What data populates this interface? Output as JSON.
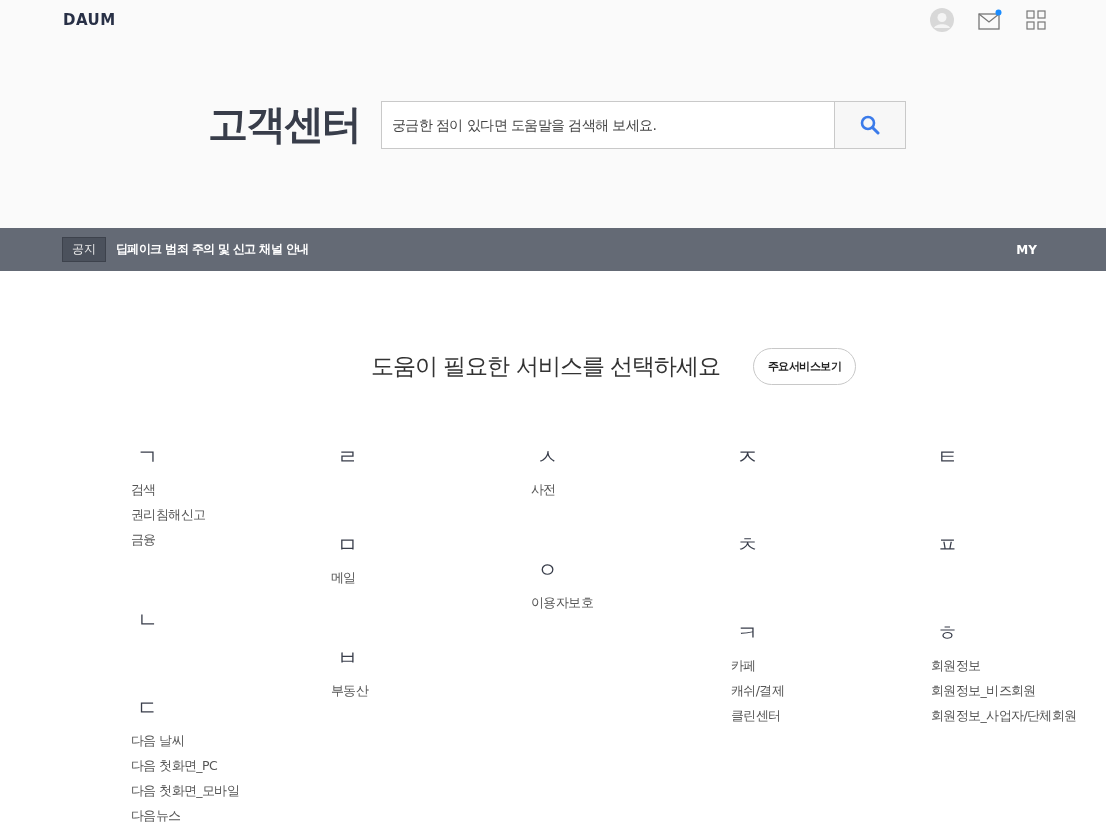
{
  "header": {
    "logo": "DAUM",
    "mail_unread": true
  },
  "hero": {
    "title": "고객센터",
    "search": {
      "placeholder": "궁금한 점이 있다면 도움말을 검색해 보세요."
    }
  },
  "notice": {
    "tag": "공지",
    "text": "딥페이크 범죄 주의 및 신고 채널 안내",
    "my_link": "MY"
  },
  "services": {
    "heading": "도움이 필요한 서비스를 선택하세요",
    "main_services_button": "주요서비스보기",
    "columns": [
      {
        "groups": [
          {
            "letter": "ㄱ",
            "items": [
              "검색",
              "권리침해신고",
              "금융"
            ]
          },
          {
            "letter": "ㄴ"
          },
          {
            "letter": "ㄷ",
            "items": [
              "다음 날씨",
              "다음 첫화면_PC",
              "다음 첫화면_모바일",
              "다음뉴스"
            ]
          }
        ]
      },
      {
        "groups": [
          {
            "letter": "ㄹ"
          },
          {
            "letter": "ㅁ",
            "items": [
              "메일"
            ]
          },
          {
            "letter": "ㅂ",
            "items": [
              "부동산"
            ]
          }
        ]
      },
      {
        "groups": [
          {
            "letter": "ㅅ",
            "items": [
              "사전"
            ]
          },
          {
            "letter": "ㅇ",
            "items": [
              "이용자보호"
            ]
          }
        ]
      },
      {
        "groups": [
          {
            "letter": "ㅈ"
          },
          {
            "letter": "ㅊ"
          },
          {
            "letter": "ㅋ",
            "items": [
              "카페",
              "캐쉬/결제",
              "클린센터"
            ]
          }
        ]
      },
      {
        "groups": [
          {
            "letter": "ㅌ"
          },
          {
            "letter": "ㅍ"
          },
          {
            "letter": "ㅎ",
            "items": [
              "회원정보",
              "회원정보_비즈회원",
              "회원정보_사업자/단체회원"
            ]
          }
        ]
      }
    ]
  }
}
